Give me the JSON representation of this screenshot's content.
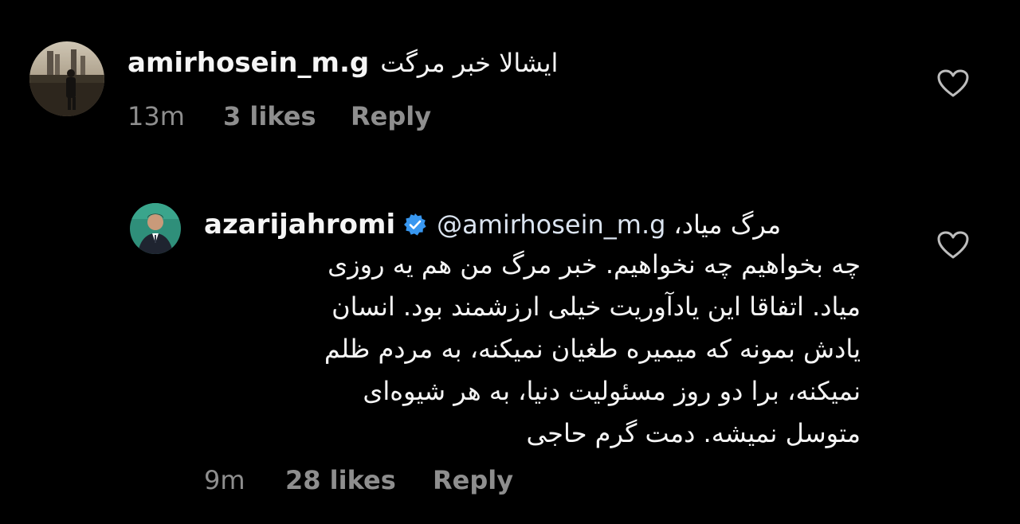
{
  "comments": [
    {
      "username": "amirhosein_m.g",
      "text": "ایشالا خبر مرگت",
      "time": "13m",
      "likes": "3 likes",
      "reply_label": "Reply",
      "avatar_icon": "profile-photo-city-skyline"
    },
    {
      "username": "azarijahromi",
      "verified": true,
      "mention": "@amirhosein_m.g",
      "first_line": "مرگ میاد،",
      "body_lines": [
        "چه بخواهیم چه نخواهیم. خبر مرگ من هم یه روزی",
        "میاد. اتفاقا این یادآوریت خیلی ارزشمند بود. انسان",
        "یادش بمونه که میمیره طغیان نمیکنه، به مردم ظلم",
        "نمیکنه، برا دو روز مسئولیت دنیا، به هر شیوه‌ای",
        "متوسل نمیشه. دمت گرم حاجی"
      ],
      "time": "9m",
      "likes": "28 likes",
      "reply_label": "Reply",
      "avatar_icon": "profile-photo-man-suit"
    }
  ],
  "colors": {
    "background": "#000000",
    "text": "#f5f5f5",
    "meta": "#8e8e8e",
    "verified": "#3897f0"
  }
}
